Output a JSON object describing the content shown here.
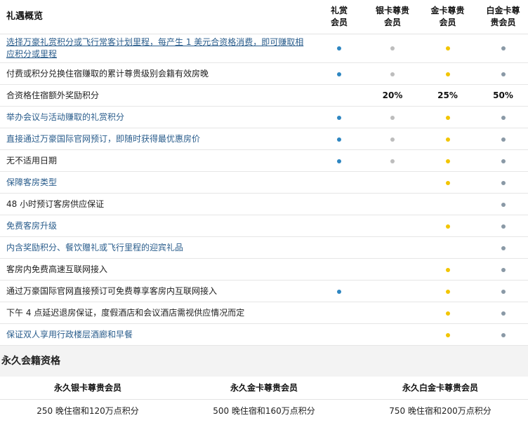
{
  "colors": {
    "blue": "#2e86c1",
    "silver": "#bdbdbd",
    "gold": "#f2c500",
    "platinum": "#8a99a6"
  },
  "header": {
    "title": "礼遇概览",
    "col1": [
      "礼赏",
      "会员"
    ],
    "col2": [
      "银卡尊贵",
      "会员"
    ],
    "col3": [
      "金卡尊贵",
      "会员"
    ],
    "col4": [
      "白金卡尊",
      "贵会员"
    ]
  },
  "rows": [
    {
      "label": [
        "选择万豪礼赏积分或飞行常客计划里程，每产生 1 美元合资格消费，即可赚取相",
        "应积分或里程"
      ],
      "style": "link-ul",
      "cells": [
        "blue",
        "silver",
        "gold",
        "platinum"
      ]
    },
    {
      "label": [
        "付费或积分兑换住宿赚取的累计尊贵级别会籍有效房晚"
      ],
      "style": "plain",
      "cells": [
        "blue",
        "silver",
        "gold",
        "platinum"
      ]
    },
    {
      "label": [
        "合资格住宿额外奖励积分"
      ],
      "style": "plain",
      "cells": [
        "",
        "20%",
        "25%",
        "50%"
      ]
    },
    {
      "label": [
        "举办会议与活动赚取的礼赏积分"
      ],
      "style": "link",
      "cells": [
        "blue",
        "silver",
        "gold",
        "platinum"
      ]
    },
    {
      "label": [
        "直接通过万豪国际官网预订，即随时获得最优惠房价"
      ],
      "style": "link",
      "cells": [
        "blue",
        "silver",
        "gold",
        "platinum"
      ]
    },
    {
      "label": [
        "无不适用日期"
      ],
      "style": "plain",
      "cells": [
        "blue",
        "silver",
        "gold",
        "platinum"
      ]
    },
    {
      "label": [
        "保障客房类型"
      ],
      "style": "link",
      "cells": [
        "",
        "",
        "gold",
        "platinum"
      ]
    },
    {
      "label": [
        "48 小时预订客房供应保证"
      ],
      "style": "plain",
      "cells": [
        "",
        "",
        "",
        "platinum"
      ]
    },
    {
      "label": [
        "免费客房升级"
      ],
      "style": "link",
      "cells": [
        "",
        "",
        "gold",
        "platinum"
      ]
    },
    {
      "label": [
        "内含奖励积分、餐饮赠礼或飞行里程的迎宾礼品"
      ],
      "style": "link",
      "cells": [
        "",
        "",
        "",
        "platinum"
      ]
    },
    {
      "label": [
        "客房内免费高速互联网接入"
      ],
      "style": "plain",
      "cells": [
        "",
        "",
        "gold",
        "platinum"
      ]
    },
    {
      "label": [
        "通过万豪国际官网直接预订可免费尊享客房内互联网接入"
      ],
      "style": "plain",
      "cells": [
        "blue",
        "",
        "gold",
        "platinum"
      ]
    },
    {
      "label": [
        "下午 4 点延迟退房保证，度假酒店和会议酒店需视供应情况而定"
      ],
      "style": "plain",
      "cells": [
        "",
        "",
        "gold",
        "platinum"
      ]
    },
    {
      "label": [
        "保证双人享用行政楼层酒廊和早餐"
      ],
      "style": "link",
      "cells": [
        "",
        "",
        "gold",
        "platinum"
      ]
    }
  ],
  "permanent": {
    "title": "永久会籍资格",
    "headers": [
      "永久银卡尊贵会员",
      "永久金卡尊贵会员",
      "永久白金卡尊贵会员"
    ],
    "values": [
      "250 晚住宿和120万点积分",
      "500 晚住宿和160万点积分",
      "750 晚住宿和200万点积分"
    ]
  }
}
